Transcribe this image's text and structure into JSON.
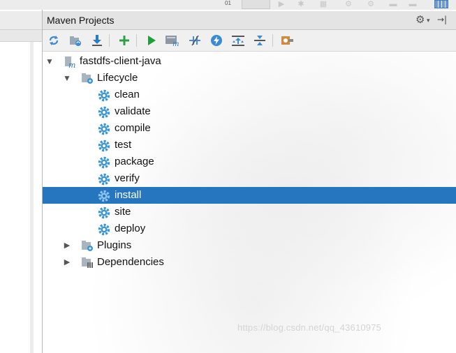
{
  "toolbar_top": {
    "counter": "01"
  },
  "panel": {
    "title": "Maven Projects",
    "settings_caret": "▾",
    "hide_glyph": "→|"
  },
  "toolbar": {
    "buttons": [
      {
        "name": "reimport-all-icon"
      },
      {
        "name": "generate-sources-icon"
      },
      {
        "name": "download-sources-icon"
      },
      {
        "name": "add-maven-projects-icon"
      },
      {
        "name": "run-maven-build-icon"
      },
      {
        "name": "execute-maven-goal-icon"
      },
      {
        "name": "toggle-offline-mode-icon"
      },
      {
        "name": "skip-tests-icon"
      },
      {
        "name": "show-dependencies-icon"
      },
      {
        "name": "collapse-all-icon"
      },
      {
        "name": "maven-settings-icon"
      }
    ]
  },
  "tree": {
    "project": "fastdfs-client-java",
    "lifecycle": "Lifecycle",
    "goals": [
      "clean",
      "validate",
      "compile",
      "test",
      "package",
      "verify",
      "install",
      "site",
      "deploy"
    ],
    "selected_goal": "install",
    "plugins": "Plugins",
    "dependencies": "Dependencies"
  },
  "watermark": "https://blog.csdn.net/qq_43610975",
  "colors": {
    "selection": "#2675bf",
    "gear": "#3a95d6",
    "run": "#1f9e3a"
  }
}
